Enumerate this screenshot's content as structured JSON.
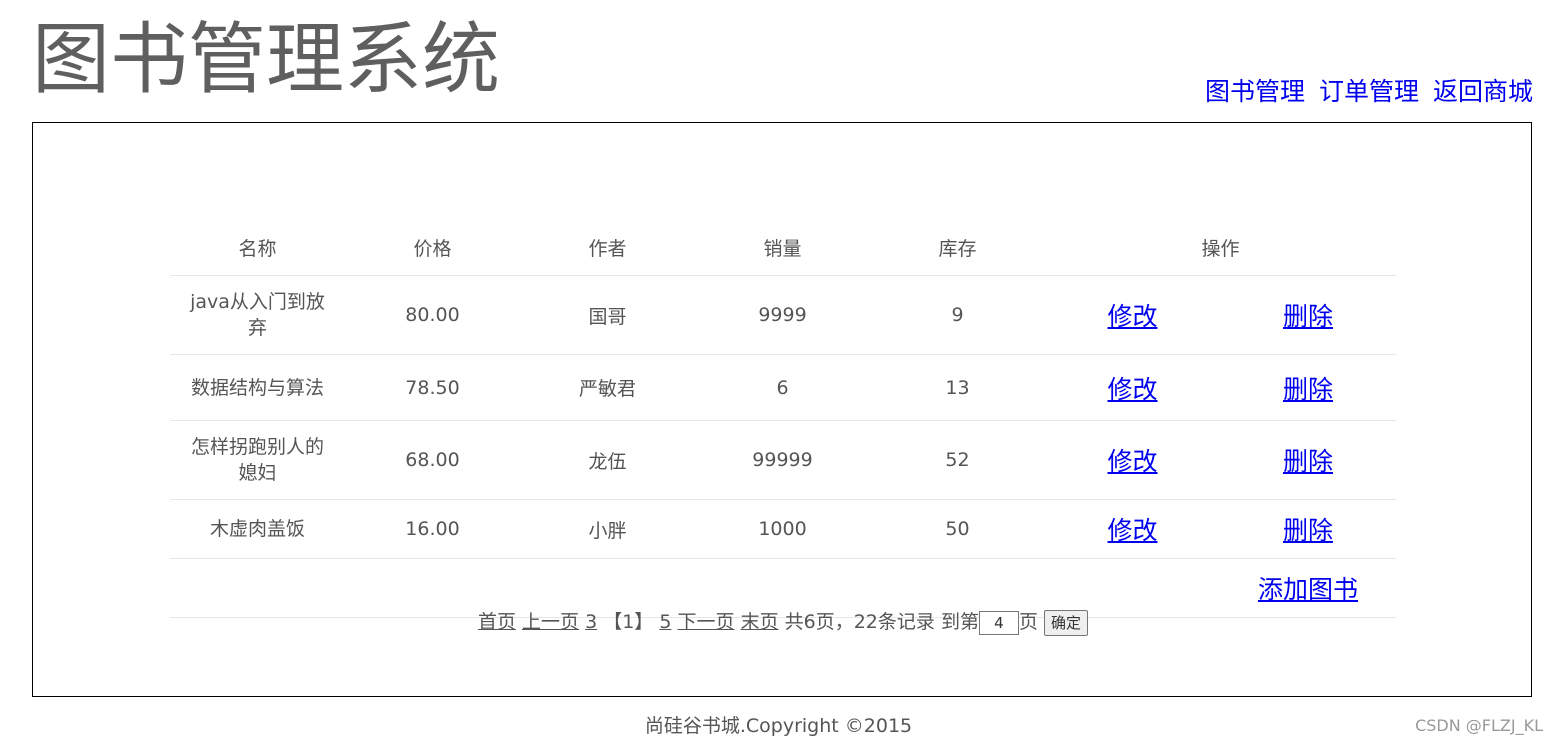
{
  "header": {
    "title": "图书管理系统",
    "nav": [
      "图书管理",
      "订单管理",
      "返回商城"
    ]
  },
  "table": {
    "columns": [
      "名称",
      "价格",
      "作者",
      "销量",
      "库存",
      "操作"
    ],
    "rows": [
      {
        "name": "java从入门到放弃",
        "price": "80.00",
        "author": "国哥",
        "sales": "9999",
        "stock": "9"
      },
      {
        "name": "数据结构与算法",
        "price": "78.50",
        "author": "严敏君",
        "sales": "6",
        "stock": "13"
      },
      {
        "name": "怎样拐跑别人的媳妇",
        "price": "68.00",
        "author": "龙伍",
        "sales": "99999",
        "stock": "52"
      },
      {
        "name": "木虚肉盖饭",
        "price": "16.00",
        "author": "小胖",
        "sales": "1000",
        "stock": "50"
      }
    ],
    "edit_label": "修改",
    "delete_label": "删除",
    "add_label": "添加图书"
  },
  "pagination": {
    "first": "首页",
    "prev": "上一页",
    "page_prev": "3",
    "current": "【1】",
    "page_next": "5",
    "next": "下一页",
    "last": "末页",
    "summary": "共6页，22条记录",
    "goto_prefix": "到第",
    "goto_value": "4",
    "goto_suffix": "页",
    "confirm": "确定"
  },
  "footer": {
    "copyright": "尚硅谷书城.Copyright ©2015",
    "watermark": "CSDN @FLZJ_KL"
  }
}
